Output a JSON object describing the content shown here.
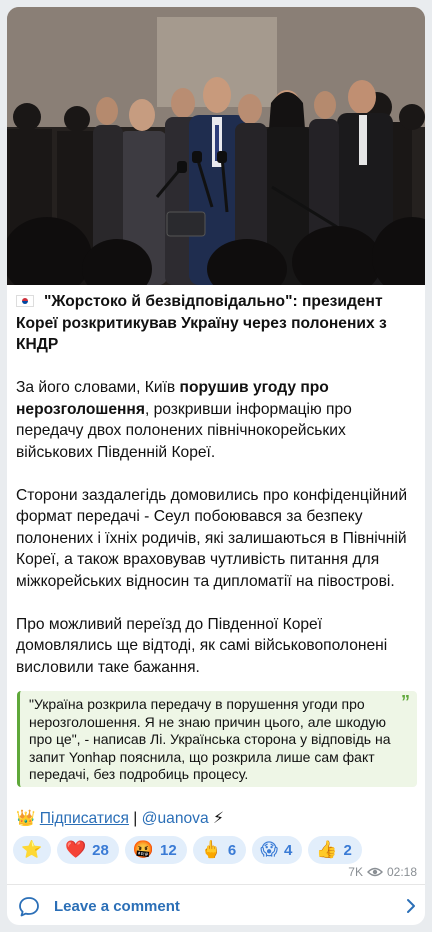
{
  "post": {
    "headline": "\"Жорстоко й безвідповідально\": президент Кореї розкритикував Україну через полонених з КНДР",
    "p1_before": "За його словами, Київ ",
    "p1_bold": "порушив угоду про нерозголошення",
    "p1_after": ", розкривши інформацію про передачу двох полонених північнокорейських військових Південній Кореї.",
    "p2": "Сторони заздалегідь домовились про конфіденційний формат передачі - Сеул побоювався за безпеку полонених і їхніх родичів, які залишаються в Північній Кореї, а також враховував чутливість питання для міжкорейських відносин та дипломатії на півострові.",
    "p3": "Про можливий переїзд до Південної Кореї домовлялись ще відтоді, як самі військовополонені висловили таке бажання.",
    "quote": "\"Україна розкрила передачу в порушення угоди про нерозголошення. Я не знаю причин цього, але шкодую про це\", - написав Лі. Українська сторона у відповідь на запит Yonhap пояснила, що розкрила лише сам факт передачі, без подробиць процесу.",
    "quote_mark": "”",
    "subscribe_emoji": "👑",
    "subscribe_label": "Підписатися",
    "separator": " | ",
    "channel_handle": "@uanova",
    "lightning": "⚡"
  },
  "reactions": [
    {
      "emoji": "⭐",
      "count": ""
    },
    {
      "emoji": "❤️",
      "count": "28"
    },
    {
      "emoji": "🤬",
      "count": "12"
    },
    {
      "emoji": "🖕",
      "count": "6"
    },
    {
      "emoji": "😱",
      "count": "4"
    },
    {
      "emoji": "👍",
      "count": "2"
    }
  ],
  "meta": {
    "views": "7K",
    "time": "02:18"
  },
  "comments": {
    "label": "Leave a comment"
  },
  "icons": {
    "views": "eye-icon",
    "comment": "comment-bubble-icon",
    "chevron": "chevron-right-icon"
  },
  "colors": {
    "accent": "#2b6fb7",
    "quote_border": "#5fa83a",
    "quote_bg": "#eef6e6",
    "reaction_bg": "#e2eefb"
  }
}
